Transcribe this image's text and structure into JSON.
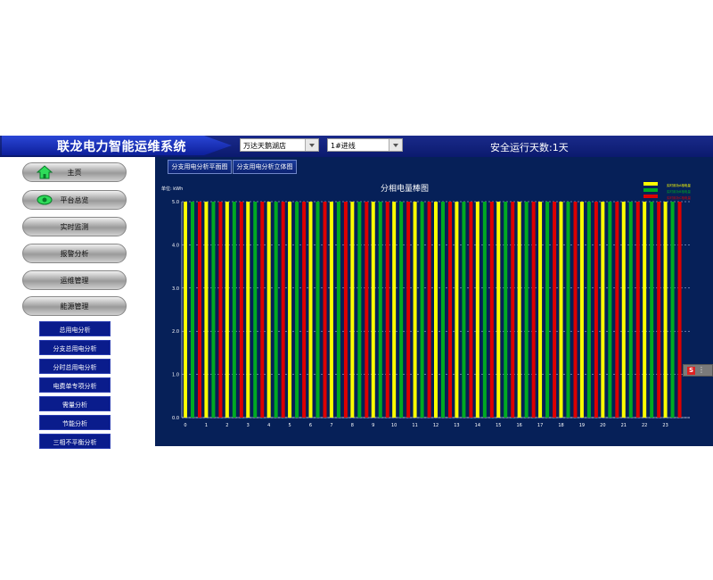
{
  "header": {
    "title": "联龙电力智能运维系统",
    "site_select": "万达天鹅湖店",
    "line_select": "1#进线",
    "safe_days_label": "安全运行天数:1天"
  },
  "sidebar": {
    "menu": [
      {
        "label": "主页",
        "icon": "home-icon"
      },
      {
        "label": "平台总览",
        "icon": "eye-icon"
      },
      {
        "label": "实时监测"
      },
      {
        "label": "报警分析"
      },
      {
        "label": "运维管理"
      },
      {
        "label": "能源管理"
      }
    ],
    "submenu": [
      {
        "label": "总用电分析"
      },
      {
        "label": "分支总用电分析"
      },
      {
        "label": "分时总用电分析"
      },
      {
        "label": "电费单专项分析"
      },
      {
        "label": "需量分析"
      },
      {
        "label": "节能分析"
      },
      {
        "label": "三相不平衡分析"
      }
    ]
  },
  "tabs": [
    {
      "label": "分支用电分析平面图"
    },
    {
      "label": "分支用电分析立体图"
    }
  ],
  "chart_data": {
    "type": "bar",
    "title": "分相电量棒图",
    "ylabel": "单位: kWh",
    "ylim": [
      0,
      5.0
    ],
    "yticks": [
      "0.0",
      "1.0",
      "2.0",
      "3.0",
      "4.0",
      "5.0"
    ],
    "categories": [
      "0",
      "1",
      "2",
      "3",
      "4",
      "5",
      "6",
      "7",
      "8",
      "9",
      "10",
      "11",
      "12",
      "13",
      "14",
      "15",
      "16",
      "17",
      "18",
      "19",
      "20",
      "21",
      "22",
      "23"
    ],
    "series": [
      {
        "name": "实时用功A相电量",
        "color": "#ffff00",
        "values": [
          5,
          5,
          5,
          5,
          5,
          5,
          5,
          5,
          5,
          5,
          5,
          5,
          5,
          5,
          5,
          5,
          5,
          5,
          5,
          5,
          5,
          5,
          5,
          5
        ]
      },
      {
        "name": "实时用功B相电量",
        "color": "#00aa22",
        "values": [
          5,
          5,
          5,
          5,
          5,
          5,
          5,
          5,
          5,
          5,
          5,
          5,
          5,
          5,
          5,
          5,
          5,
          5,
          5,
          5,
          5,
          5,
          5,
          5
        ]
      },
      {
        "name": "实时用功C相电量",
        "color": "#dd0000",
        "values": [
          5,
          5,
          5,
          5,
          5,
          5,
          5,
          5,
          5,
          5,
          5,
          5,
          5,
          5,
          5,
          5,
          5,
          5,
          5,
          5,
          5,
          5,
          5,
          5
        ]
      }
    ],
    "grid": true,
    "legend": "top-right"
  },
  "float_widget": {
    "badge": "S",
    "dots": "⋮"
  }
}
